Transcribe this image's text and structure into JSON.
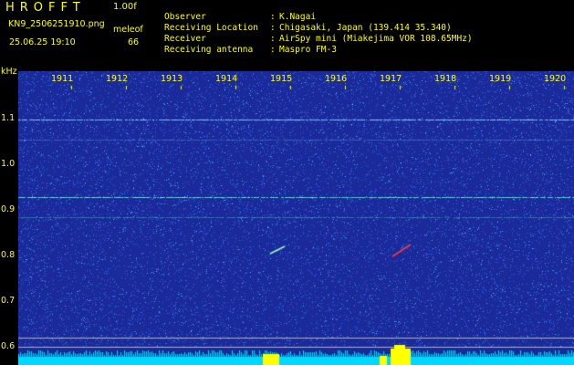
{
  "header": {
    "app_title": "HROFFT",
    "version": "1.00f",
    "filename": "KN9_2506251910.png",
    "datetime": "25.06.25 19:10",
    "counter_label": "meleof",
    "counter_value": "66"
  },
  "info": {
    "rows": [
      {
        "key": "Observer",
        "value": "K.Nagai"
      },
      {
        "key": "Receiving Location",
        "value": "Chigasaki, Japan (139.414 35.340)"
      },
      {
        "key": "Receiver",
        "value": "AirSpy mini (Miakejima VOR 108.65MHz)"
      },
      {
        "key": "Receiving antenna",
        "value": "Maspro FM-3"
      }
    ]
  },
  "spectrogram": {
    "y_unit": "kHz",
    "y_ticks": [
      "1.1",
      "1.0",
      "0.9",
      "0.8",
      "0.7",
      "0.6"
    ],
    "x_ticks": [
      "1911",
      "1912",
      "1913",
      "1914",
      "1915",
      "1916",
      "1917",
      "1918",
      "1919",
      "1920"
    ],
    "colors": {
      "background": "#1a2a9a",
      "noise_light": "#4fb0ff",
      "noise_mid": "#3a55d8",
      "carrier": "#58e0d0",
      "signal_red": "#ff3a3a",
      "bottom_band": "#00d8ff",
      "peak": "#ffff00",
      "axis_text": "#ffff00"
    }
  }
}
